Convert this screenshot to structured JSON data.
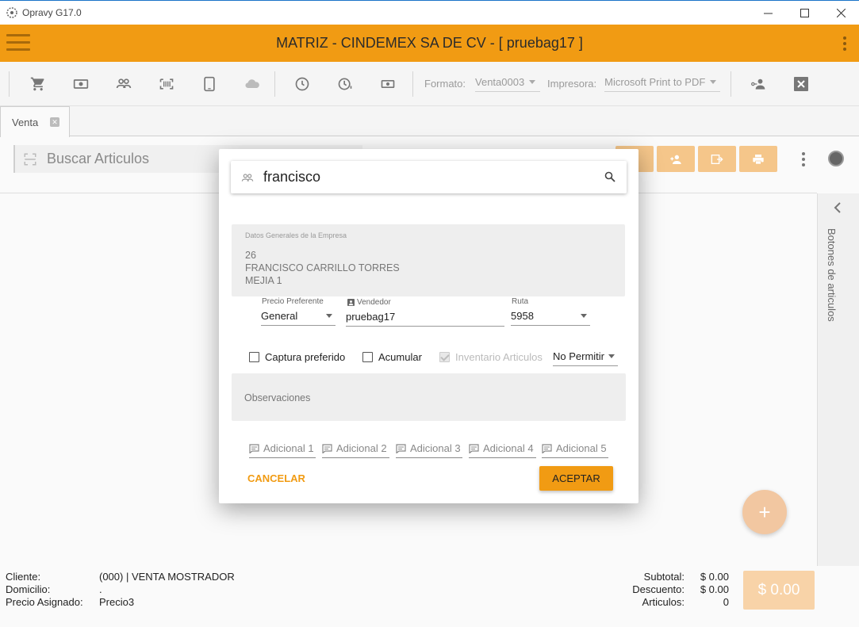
{
  "window": {
    "title": "Opravy G17.0"
  },
  "header": {
    "title": "MATRIZ - CINDEMEX SA DE CV - [ pruebag17 ]"
  },
  "toolbar": {
    "icons": [
      "cart-icon",
      "money-icon",
      "people-icon",
      "barcode-icon",
      "tablet-icon",
      "cloud-icon",
      "clock-icon",
      "clock-alert-icon",
      "cash-icon",
      "person-link-icon",
      "close-box-icon"
    ],
    "formato_label": "Formato:",
    "formato_value": "Venta0003",
    "impresora_label": "Impresora:",
    "impresora_value": "Microsoft Print to PDF"
  },
  "tabs": [
    {
      "label": "Venta"
    }
  ],
  "main": {
    "search_placeholder": "Buscar Articulos"
  },
  "sidepanel": {
    "label": "Botones de articulos"
  },
  "footer": {
    "cliente_label": "Cliente:",
    "cliente_value": "(000) | VENTA MOSTRADOR",
    "domicilio_label": "Domicilio:",
    "domicilio_value": ".",
    "precio_label": "Precio Asignado:",
    "precio_value": "Precio3",
    "subtotal_label": "Subtotal:",
    "subtotal_value": "$ 0.00",
    "descuento_label": "Descuento:",
    "descuento_value": "$ 0.00",
    "articulos_label": "Articulos:",
    "articulos_value": "0",
    "total_button": "$ 0.00"
  },
  "dialog": {
    "search_value": "francisco",
    "company_title": "Datos Generales de la Empresa",
    "company_lines": [
      "26",
      "FRANCISCO CARRILLO TORRES",
      "MEJIA 1"
    ],
    "precio_label": "Precio Preferente",
    "precio_value": "General",
    "vendedor_label": "Vendedor",
    "vendedor_value": "pruebag17",
    "ruta_label": "Ruta",
    "ruta_value": "5958",
    "captura_label": "Captura preferido",
    "acumular_label": "Acumular",
    "inventario_label": "Inventario Articulos",
    "permitir_value": "No Permitir",
    "observaciones_label": "Observaciones",
    "adicionales": [
      "Adicional 1",
      "Adicional 2",
      "Adicional 3",
      "Adicional 4",
      "Adicional 5"
    ],
    "cancel_label": "CANCELAR",
    "ok_label": "ACEPTAR"
  },
  "colors": {
    "accent": "#f19b13",
    "accent_light": "#f5c68a"
  }
}
